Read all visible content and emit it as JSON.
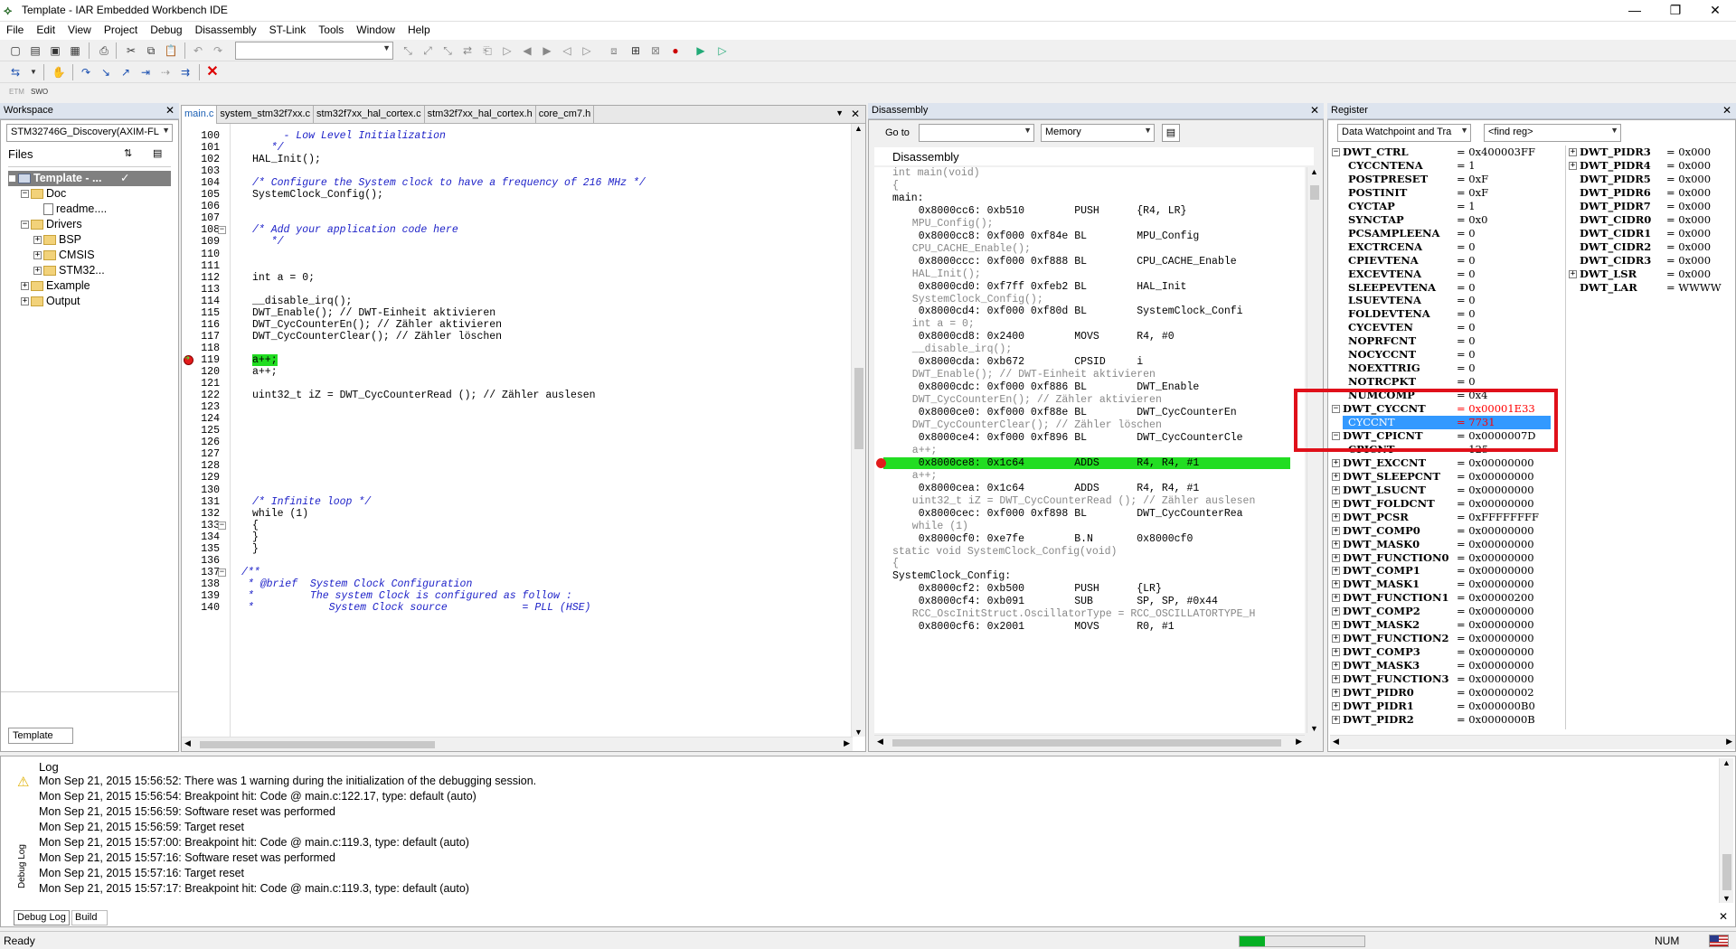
{
  "window": {
    "title": "Template - IAR Embedded Workbench IDE",
    "min": "—",
    "max": "❐",
    "close": "✕"
  },
  "menu": [
    "File",
    "Edit",
    "View",
    "Project",
    "Debug",
    "Disassembly",
    "ST-Link",
    "Tools",
    "Window",
    "Help"
  ],
  "toolbar3": [
    "ETM",
    "SWO"
  ],
  "workspace": {
    "header": "Workspace",
    "config": "STM32746G_Discovery(AXIM-FL",
    "files_label": "Files",
    "tree": [
      {
        "depth": 0,
        "exp": "⊟",
        "icon": "project",
        "label": "Template - ...",
        "selected": true
      },
      {
        "depth": 1,
        "exp": "⊟",
        "icon": "folder",
        "label": "Doc"
      },
      {
        "depth": 2,
        "exp": "",
        "icon": "file",
        "label": "readme...."
      },
      {
        "depth": 1,
        "exp": "⊟",
        "icon": "folder",
        "label": "Drivers"
      },
      {
        "depth": 2,
        "exp": "⊞",
        "icon": "folder",
        "label": "BSP"
      },
      {
        "depth": 2,
        "exp": "⊞",
        "icon": "folder",
        "label": "CMSIS"
      },
      {
        "depth": 2,
        "exp": "⊞",
        "icon": "folder",
        "label": "STM32..."
      },
      {
        "depth": 1,
        "exp": "⊞",
        "icon": "folder",
        "label": "Example"
      },
      {
        "depth": 1,
        "exp": "⊞",
        "icon": "folder",
        "label": "Output"
      }
    ],
    "tab": "Template"
  },
  "editor": {
    "tabs": [
      "main.c",
      "system_stm32f7xx.c",
      "stm32f7xx_hal_cortex.c",
      "stm32f7xx_hal_cortex.h",
      "core_cm7.h"
    ],
    "active_tab": 0,
    "lines": [
      {
        "n": "100",
        "t": "     - Low Level Initialization",
        "c": "cm"
      },
      {
        "n": "101",
        "t": "   */",
        "c": "cm"
      },
      {
        "n": "102",
        "t": "HAL_Init();",
        "c": ""
      },
      {
        "n": "103",
        "t": "",
        "c": ""
      },
      {
        "n": "104",
        "t": "/* Configure the System clock to have a frequency of 216 MHz */",
        "c": "cm"
      },
      {
        "n": "105",
        "t": "SystemClock_Config();",
        "c": ""
      },
      {
        "n": "106",
        "t": "",
        "c": ""
      },
      {
        "n": "107",
        "t": "",
        "c": ""
      },
      {
        "n": "108",
        "t": "/* Add your application code here",
        "c": "cm"
      },
      {
        "n": "109",
        "t": "   */",
        "c": "cm"
      },
      {
        "n": "110",
        "t": "",
        "c": ""
      },
      {
        "n": "111",
        "t": "",
        "c": ""
      },
      {
        "n": "112",
        "t": "int a = 0;",
        "c": ""
      },
      {
        "n": "113",
        "t": "",
        "c": ""
      },
      {
        "n": "114",
        "t": "__disable_irq();",
        "c": ""
      },
      {
        "n": "115",
        "t": "DWT_Enable(); // DWT-Einheit aktivieren",
        "c": "mix"
      },
      {
        "n": "116",
        "t": "DWT_CycCounterEn(); // Zähler aktivieren",
        "c": "mix"
      },
      {
        "n": "117",
        "t": "DWT_CycCounterClear(); // Zähler löschen",
        "c": "mix"
      },
      {
        "n": "118",
        "t": "",
        "c": ""
      },
      {
        "n": "119",
        "t": "a++;",
        "c": "hl"
      },
      {
        "n": "120",
        "t": "a++;",
        "c": ""
      },
      {
        "n": "121",
        "t": "",
        "c": ""
      },
      {
        "n": "122",
        "t": "uint32_t iZ = DWT_CycCounterRead (); // Zähler auslesen",
        "c": "mix"
      },
      {
        "n": "123",
        "t": "",
        "c": ""
      },
      {
        "n": "124",
        "t": "",
        "c": ""
      },
      {
        "n": "125",
        "t": "",
        "c": ""
      },
      {
        "n": "126",
        "t": "",
        "c": ""
      },
      {
        "n": "127",
        "t": "",
        "c": ""
      },
      {
        "n": "128",
        "t": "",
        "c": ""
      },
      {
        "n": "129",
        "t": "",
        "c": ""
      },
      {
        "n": "130",
        "t": "",
        "c": ""
      },
      {
        "n": "131",
        "t": "/* Infinite loop */",
        "c": "cm"
      },
      {
        "n": "132",
        "t": "while (1)",
        "c": ""
      },
      {
        "n": "133",
        "t": "{",
        "c": ""
      },
      {
        "n": "134",
        "t": "}",
        "c": ""
      },
      {
        "n": "135",
        "t": "}",
        "c": ""
      },
      {
        "n": "136",
        "t": "",
        "c": ""
      },
      {
        "n": "137",
        "t": "/**",
        "c": "cm0"
      },
      {
        "n": "138",
        "t": " * @brief  System Clock Configuration",
        "c": "cm0"
      },
      {
        "n": "139",
        "t": " *         The system Clock is configured as follow :",
        "c": "cm0"
      },
      {
        "n": "140",
        "t": " *            System Clock source            = PLL (HSE)",
        "c": "cm0"
      }
    ]
  },
  "disassembly": {
    "header": "Disassembly",
    "goto_label": "Go to",
    "memory_label": "Memory",
    "title": "Disassembly",
    "lines": [
      {
        "t": "int main(void)",
        "k": "src0"
      },
      {
        "t": "{",
        "k": "src0"
      },
      {
        "t": "main:",
        "k": "lbl0"
      },
      {
        "t": "   0x8000cc6: 0xb510        PUSH      {R4, LR}",
        "k": "ins"
      },
      {
        "t": "  MPU_Config();",
        "k": "src"
      },
      {
        "t": "   0x8000cc8: 0xf000 0xf84e BL        MPU_Config",
        "k": "ins"
      },
      {
        "t": "  CPU_CACHE_Enable();",
        "k": "src"
      },
      {
        "t": "   0x8000ccc: 0xf000 0xf888 BL        CPU_CACHE_Enable",
        "k": "ins"
      },
      {
        "t": "  HAL_Init();",
        "k": "src"
      },
      {
        "t": "   0x8000cd0: 0xf7ff 0xfeb2 BL        HAL_Init",
        "k": "ins"
      },
      {
        "t": "  SystemClock_Config();",
        "k": "src"
      },
      {
        "t": "   0x8000cd4: 0xf000 0xf80d BL        SystemClock_Confi",
        "k": "ins"
      },
      {
        "t": "  int a = 0;",
        "k": "src"
      },
      {
        "t": "   0x8000cd8: 0x2400        MOVS      R4, #0",
        "k": "ins"
      },
      {
        "t": "  __disable_irq();",
        "k": "src"
      },
      {
        "t": "   0x8000cda: 0xb672        CPSID     i",
        "k": "ins"
      },
      {
        "t": "  DWT_Enable(); // DWT-Einheit aktivieren",
        "k": "src"
      },
      {
        "t": "   0x8000cdc: 0xf000 0xf886 BL        DWT_Enable",
        "k": "ins"
      },
      {
        "t": "  DWT_CycCounterEn(); // Zähler aktivieren",
        "k": "src"
      },
      {
        "t": "   0x8000ce0: 0xf000 0xf88e BL        DWT_CycCounterEn",
        "k": "ins"
      },
      {
        "t": "  DWT_CycCounterClear(); // Zähler löschen",
        "k": "src"
      },
      {
        "t": "   0x8000ce4: 0xf000 0xf896 BL        DWT_CycCounterCle",
        "k": "ins"
      },
      {
        "t": "  a++;",
        "k": "src"
      },
      {
        "t": "   0x8000ce8: 0x1c64        ADDS      R4, R4, #1",
        "k": "cur"
      },
      {
        "t": "  a++;",
        "k": "src"
      },
      {
        "t": "   0x8000cea: 0x1c64        ADDS      R4, R4, #1",
        "k": "ins"
      },
      {
        "t": "  uint32_t iZ = DWT_CycCounterRead (); // Zähler auslesen",
        "k": "src"
      },
      {
        "t": "   0x8000cec: 0xf000 0xf898 BL        DWT_CycCounterRea",
        "k": "ins"
      },
      {
        "t": "  while (1)",
        "k": "src"
      },
      {
        "t": "   0x8000cf0: 0xe7fe        B.N       0x8000cf0",
        "k": "ins"
      },
      {
        "t": "static void SystemClock_Config(void)",
        "k": "src0"
      },
      {
        "t": "{",
        "k": "src0"
      },
      {
        "t": "SystemClock_Config:",
        "k": "lbl0"
      },
      {
        "t": "   0x8000cf2: 0xb500        PUSH      {LR}",
        "k": "ins"
      },
      {
        "t": "   0x8000cf4: 0xb091        SUB       SP, SP, #0x44",
        "k": "ins"
      },
      {
        "t": "  RCC_OscInitStruct.OscillatorType = RCC_OSCILLATORTYPE_H",
        "k": "src"
      },
      {
        "t": "   0x8000cf6: 0x2001        MOVS      R0, #1",
        "k": "ins"
      }
    ]
  },
  "register": {
    "header": "Register",
    "group": "Data Watchpoint and Tra",
    "find": "<find reg>",
    "left": [
      {
        "e": "⊟",
        "name": "DWT_CTRL",
        "val": "= 0x400003FF",
        "b": true,
        "ind": 0
      },
      {
        "e": "",
        "name": "CYCCNTENA",
        "val": "= 1",
        "b": true,
        "ind": 1
      },
      {
        "e": "",
        "name": "POSTPRESET",
        "val": "= 0xF",
        "b": true,
        "ind": 1
      },
      {
        "e": "",
        "name": "POSTINIT",
        "val": "= 0xF",
        "b": true,
        "ind": 1
      },
      {
        "e": "",
        "name": "CYCTAP",
        "val": "= 1",
        "b": true,
        "ind": 1
      },
      {
        "e": "",
        "name": "SYNCTAP",
        "val": "= 0x0",
        "b": true,
        "ind": 1
      },
      {
        "e": "",
        "name": "PCSAMPLEENA",
        "val": "= 0",
        "b": true,
        "ind": 1
      },
      {
        "e": "",
        "name": "EXCTRCENA",
        "val": "= 0",
        "b": true,
        "ind": 1
      },
      {
        "e": "",
        "name": "CPIEVTENA",
        "val": "= 0",
        "b": true,
        "ind": 1
      },
      {
        "e": "",
        "name": "EXCEVTENA",
        "val": "= 0",
        "b": true,
        "ind": 1
      },
      {
        "e": "",
        "name": "SLEEPEVTENA",
        "val": "= 0",
        "b": true,
        "ind": 1
      },
      {
        "e": "",
        "name": "LSUEVTENA",
        "val": "= 0",
        "b": true,
        "ind": 1
      },
      {
        "e": "",
        "name": "FOLDEVTENA",
        "val": "= 0",
        "b": true,
        "ind": 1
      },
      {
        "e": "",
        "name": "CYCEVTEN",
        "val": "= 0",
        "b": true,
        "ind": 1
      },
      {
        "e": "",
        "name": "NOPRFCNT",
        "val": "= 0",
        "b": true,
        "ind": 1
      },
      {
        "e": "",
        "name": "NOCYCCNT",
        "val": "= 0",
        "b": true,
        "ind": 1
      },
      {
        "e": "",
        "name": "NOEXTTRIG",
        "val": "= 0",
        "b": true,
        "ind": 1
      },
      {
        "e": "",
        "name": "NOTRCPKT",
        "val": "= 0",
        "b": true,
        "ind": 1
      },
      {
        "e": "",
        "name": "NUMCOMP",
        "val": "= 0x4",
        "b": true,
        "ind": 1
      },
      {
        "e": "⊟",
        "name": "DWT_CYCCNT",
        "val": "= 0x00001E33",
        "b": true,
        "ind": 0,
        "red": true
      },
      {
        "e": "",
        "name": "CYCCNT",
        "val": "= 7731",
        "b": false,
        "ind": 1,
        "sel": true
      },
      {
        "e": "⊟",
        "name": "DWT_CPICNT",
        "val": "= 0x0000007D",
        "b": true,
        "ind": 0
      },
      {
        "e": "",
        "name": "CPICNT",
        "val": "= 125",
        "b": true,
        "ind": 1
      },
      {
        "e": "⊞",
        "name": "DWT_EXCCNT",
        "val": "= 0x00000000",
        "b": true,
        "ind": 0
      },
      {
        "e": "⊞",
        "name": "DWT_SLEEPCNT",
        "val": "= 0x00000000",
        "b": true,
        "ind": 0
      },
      {
        "e": "⊞",
        "name": "DWT_LSUCNT",
        "val": "= 0x00000000",
        "b": true,
        "ind": 0
      },
      {
        "e": "⊞",
        "name": "DWT_FOLDCNT",
        "val": "= 0x00000000",
        "b": true,
        "ind": 0
      },
      {
        "e": "⊞",
        "name": "DWT_PCSR",
        "val": "= 0xFFFFFFFF",
        "b": true,
        "ind": 0
      },
      {
        "e": "⊞",
        "name": "DWT_COMP0",
        "val": "= 0x00000000",
        "b": true,
        "ind": 0
      },
      {
        "e": "⊞",
        "name": "DWT_MASK0",
        "val": "= 0x00000000",
        "b": true,
        "ind": 0
      },
      {
        "e": "⊞",
        "name": "DWT_FUNCTION0",
        "val": "= 0x00000000",
        "b": true,
        "ind": 0
      },
      {
        "e": "⊞",
        "name": "DWT_COMP1",
        "val": "= 0x00000000",
        "b": true,
        "ind": 0
      },
      {
        "e": "⊞",
        "name": "DWT_MASK1",
        "val": "= 0x00000000",
        "b": true,
        "ind": 0
      },
      {
        "e": "⊞",
        "name": "DWT_FUNCTION1",
        "val": "= 0x00000200",
        "b": true,
        "ind": 0
      },
      {
        "e": "⊞",
        "name": "DWT_COMP2",
        "val": "= 0x00000000",
        "b": true,
        "ind": 0
      },
      {
        "e": "⊞",
        "name": "DWT_MASK2",
        "val": "= 0x00000000",
        "b": true,
        "ind": 0
      },
      {
        "e": "⊞",
        "name": "DWT_FUNCTION2",
        "val": "= 0x00000000",
        "b": true,
        "ind": 0
      },
      {
        "e": "⊞",
        "name": "DWT_COMP3",
        "val": "= 0x00000000",
        "b": true,
        "ind": 0
      },
      {
        "e": "⊞",
        "name": "DWT_MASK3",
        "val": "= 0x00000000",
        "b": true,
        "ind": 0
      },
      {
        "e": "⊞",
        "name": "DWT_FUNCTION3",
        "val": "= 0x00000000",
        "b": true,
        "ind": 0
      },
      {
        "e": "⊞",
        "name": "DWT_PIDR0",
        "val": "= 0x00000002",
        "b": true,
        "ind": 0
      },
      {
        "e": "⊞",
        "name": "DWT_PIDR1",
        "val": "= 0x000000B0",
        "b": true,
        "ind": 0
      },
      {
        "e": "⊞",
        "name": "DWT_PIDR2",
        "val": "= 0x0000000B",
        "b": true,
        "ind": 0
      }
    ],
    "right": [
      {
        "e": "⊞",
        "name": "DWT_PIDR3",
        "val": "= 0x000"
      },
      {
        "e": "⊞",
        "name": "DWT_PIDR4",
        "val": "= 0x000"
      },
      {
        "e": "",
        "name": "DWT_PIDR5",
        "val": "= 0x000"
      },
      {
        "e": "",
        "name": "DWT_PIDR6",
        "val": "= 0x000"
      },
      {
        "e": "",
        "name": "DWT_PIDR7",
        "val": "= 0x000"
      },
      {
        "e": "",
        "name": "DWT_CIDR0",
        "val": "= 0x000"
      },
      {
        "e": "",
        "name": "DWT_CIDR1",
        "val": "= 0x000"
      },
      {
        "e": "",
        "name": "DWT_CIDR2",
        "val": "= 0x000"
      },
      {
        "e": "",
        "name": "DWT_CIDR3",
        "val": "= 0x000"
      },
      {
        "e": "⊞",
        "name": "DWT_LSR",
        "val": "= 0x000"
      },
      {
        "e": "",
        "name": "DWT_LAR",
        "val": "= WWWW"
      }
    ]
  },
  "log": {
    "title": "Log",
    "side_label": "Debug Log",
    "entries": [
      {
        "warn": true,
        "t": "Mon Sep 21, 2015 15:56:52: There was 1 warning during the initialization of the debugging session."
      },
      {
        "warn": false,
        "t": "Mon Sep 21, 2015 15:56:54: Breakpoint hit: Code @ main.c:122.17, type: default (auto)"
      },
      {
        "warn": false,
        "t": "Mon Sep 21, 2015 15:56:59: Software reset was performed"
      },
      {
        "warn": false,
        "t": "Mon Sep 21, 2015 15:56:59: Target reset"
      },
      {
        "warn": false,
        "t": "Mon Sep 21, 2015 15:57:00: Breakpoint hit: Code @ main.c:119.3, type: default (auto)"
      },
      {
        "warn": false,
        "t": "Mon Sep 21, 2015 15:57:16: Software reset was performed"
      },
      {
        "warn": false,
        "t": "Mon Sep 21, 2015 15:57:16: Target reset"
      },
      {
        "warn": false,
        "t": "Mon Sep 21, 2015 15:57:17: Breakpoint hit: Code @ main.c:119.3, type: default (auto)"
      }
    ],
    "tabs": [
      "Debug Log",
      "Build"
    ]
  },
  "status": {
    "left": "Ready",
    "num": "NUM",
    "progress": 0.2
  },
  "colors": {
    "highlight_green": "#22dd22",
    "annotation_red": "#e0101a",
    "selection_blue": "#3399ff",
    "changed_red": "#ff0000"
  }
}
